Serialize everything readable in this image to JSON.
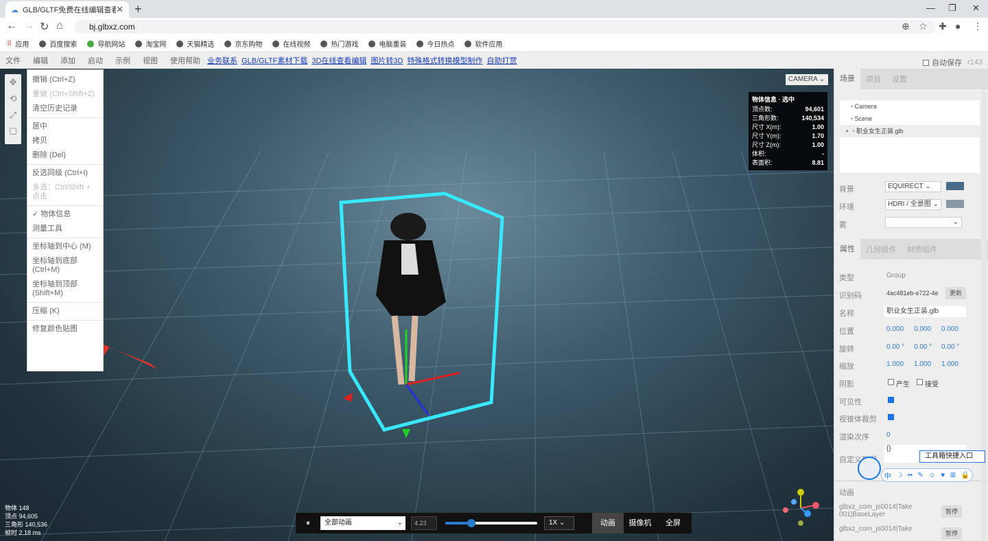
{
  "browser": {
    "tab_title": "GLB/GLTF免费在线编辑查看转换",
    "url": "bj.glbxz.com",
    "bookmarks": [
      "应用",
      "百度搜索",
      "导航网站",
      "淘宝网",
      "天猫精选",
      "京东购物",
      "在线视频",
      "热门游戏",
      "电脑重装",
      "今日热点",
      "软件应用"
    ]
  },
  "menubar": {
    "items": [
      "文件",
      "编辑",
      "添加",
      "启动",
      "示例",
      "视图",
      "使用帮助"
    ],
    "links": [
      "业务联系",
      "GLB/GLTF素材下载",
      "3D在线查看编辑",
      "图片转3D",
      "特殊格式转换模型制作",
      "自助打赏"
    ],
    "autosave": "自动保存",
    "version": "r143"
  },
  "edit_menu": {
    "undo": "撤销 (Ctrl+Z)",
    "redo": "重做 (Ctrl+Shift+Z)",
    "clear_history": "清空历史记录",
    "center": "居中",
    "copy": "拷贝",
    "delete": "删除 (Del)",
    "invert_select": "反选同级 (Ctrl+I)",
    "multi_select": "多选：Ctrl/Shift + 点击",
    "object_info": "✓ 物体信息",
    "measure": "测量工具",
    "pivot_center": "坐标轴到中心 (M)",
    "pivot_bottom": "坐标轴到底部 (Ctrl+M)",
    "pivot_top": "坐标轴到顶部 (Shift+M)",
    "compress": "压缩 (K)",
    "fix_color": "修复颜色贴图"
  },
  "viewport": {
    "camera_select": "CAMERA",
    "info_title": "物体信息 · 选中",
    "info": [
      {
        "k": "顶点数:",
        "v": "94,601"
      },
      {
        "k": "三角形数:",
        "v": "140,534"
      },
      {
        "k": "尺寸 X(m):",
        "v": "1.00"
      },
      {
        "k": "尺寸 Y(m):",
        "v": "1.70"
      },
      {
        "k": "尺寸 Z(m):",
        "v": "1.00"
      },
      {
        "k": "体积:",
        "v": "-"
      },
      {
        "k": "表面积:",
        "v": "8.81"
      }
    ],
    "stats": {
      "objects": "物体  148",
      "vertices": "顶点  94,605",
      "triangles": "三角形  140,536",
      "frametime": "帧时  2.18 ms"
    }
  },
  "player": {
    "pause_icon": "⏸",
    "anim_select": "全部动画",
    "time": "4.23",
    "progress": 0.28,
    "speed": "1X",
    "buttons": [
      "动画",
      "摄像机",
      "全屏"
    ]
  },
  "panel": {
    "tabs": [
      "场景",
      "项目",
      "设置"
    ],
    "outliner": [
      "Camera",
      "Scene",
      "职业女生正装.glb"
    ],
    "background_label": "背景",
    "background_value": "EQUIRECT",
    "env_label": "环境",
    "env_value": "HDRI / 全景图",
    "fog_label": "雾",
    "prop_tabs": [
      "属性",
      "几何组件",
      "材质组件"
    ],
    "type_label": "类型",
    "type_value": "Group",
    "uuid_label": "识别码",
    "uuid_value": "4ac481eb-e722-4e",
    "update": "更新",
    "name_label": "名称",
    "name_value": "职业女生正装.glb",
    "pos_label": "位置",
    "pos": [
      "0.000",
      "0.000",
      "0.000"
    ],
    "rot_label": "旋转",
    "rot": [
      "0.00 °",
      "0.00 °",
      "0.00 °"
    ],
    "scale_label": "缩放",
    "scale": [
      "1.000",
      "1.000",
      "1.000"
    ],
    "shadow_label": "阴影",
    "cast": "产生",
    "receive": "接受",
    "visible_label": "可见性",
    "frustum_label": "视锥体裁剪",
    "order_label": "渲染次序",
    "order_value": "0",
    "custom_label": "自定义数据",
    "custom_value": "{}",
    "anim_label": "动画",
    "anims": [
      "glbxz_com_js0014|Take 001|BaseLayer",
      "glbxz_com_js0014|Take"
    ],
    "pause": "暂停"
  },
  "assistant": {
    "label": "工具箱快捷入口",
    "icons": [
      "中",
      "☽",
      "••",
      "✎",
      "☺",
      "♥",
      "⊞",
      "🔒"
    ]
  }
}
